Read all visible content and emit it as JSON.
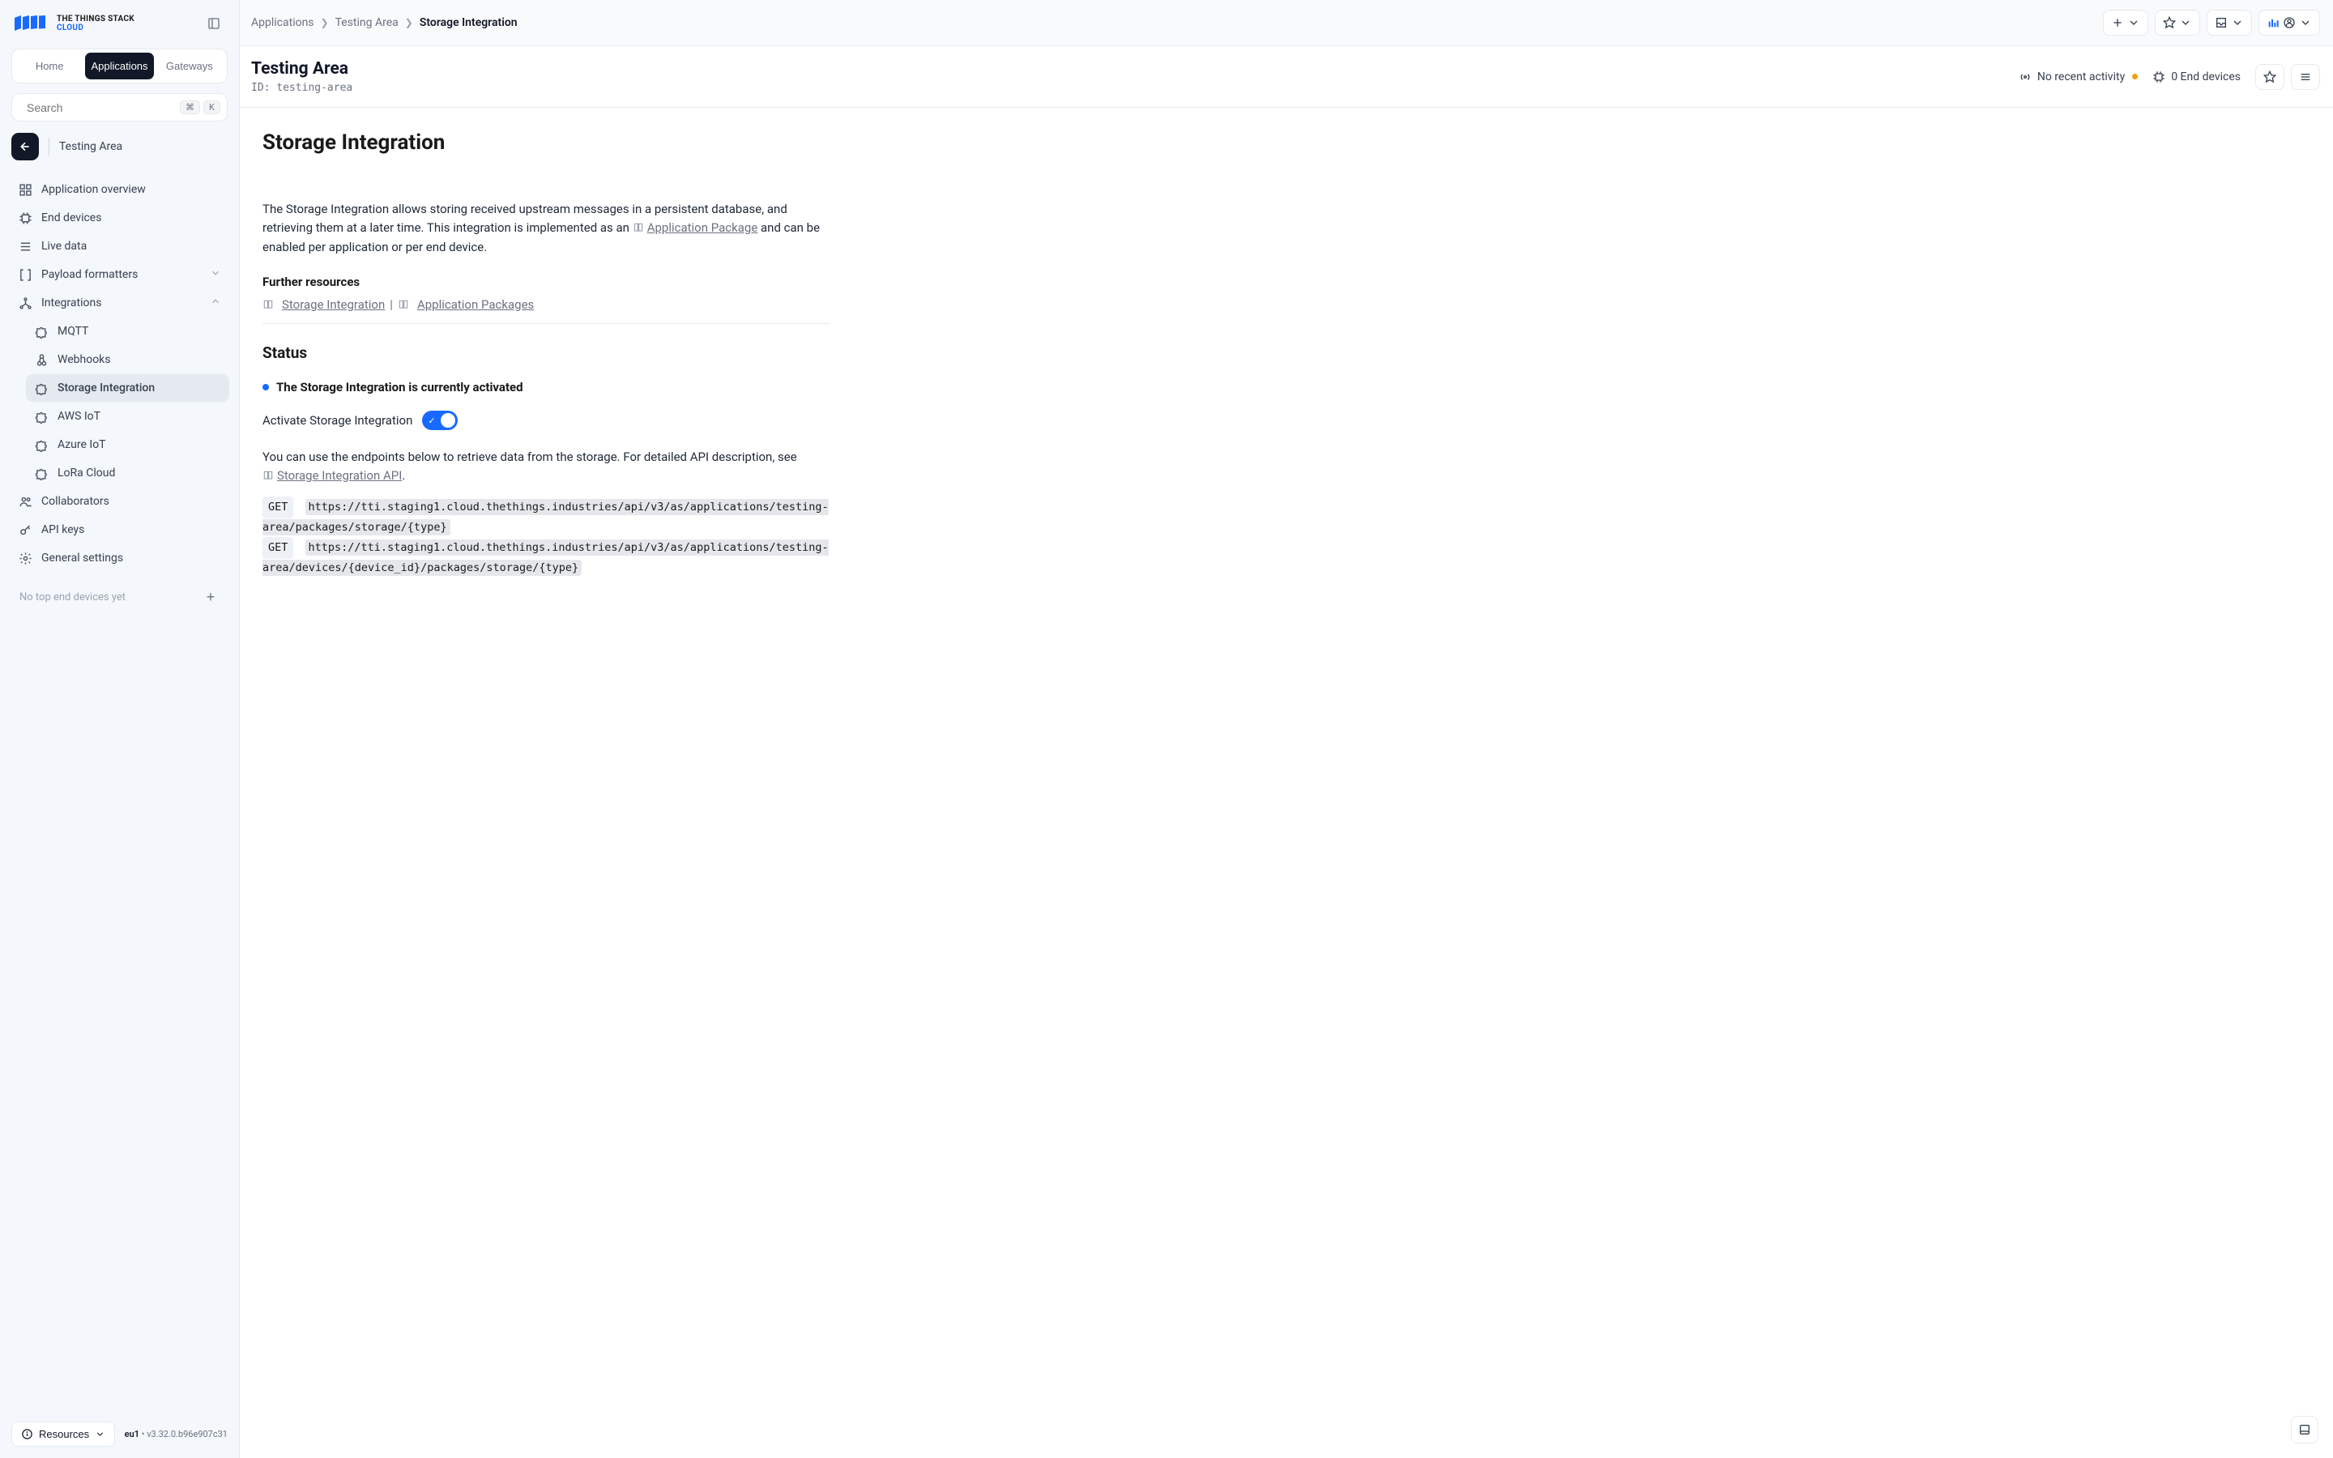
{
  "brand": {
    "title": "THE THINGS STACK",
    "subtitle": "CLOUD"
  },
  "tabs": {
    "home": "Home",
    "applications": "Applications",
    "gateways": "Gateways"
  },
  "search": {
    "placeholder": "Search",
    "kbd1": "⌘",
    "kbd2": "K"
  },
  "context": {
    "name": "Testing Area"
  },
  "nav": {
    "overview": "Application overview",
    "end_devices": "End devices",
    "live_data": "Live data",
    "payload": "Payload formatters",
    "integrations": "Integrations",
    "mqtt": "MQTT",
    "webhooks": "Webhooks",
    "storage": "Storage Integration",
    "aws": "AWS IoT",
    "azure": "Azure IoT",
    "lora": "LoRa Cloud",
    "collaborators": "Collaborators",
    "api_keys": "API keys",
    "general": "General settings"
  },
  "top_devices_empty": "No top end devices yet",
  "footer": {
    "resources": "Resources",
    "region": "eu1",
    "separator": " • ",
    "version": "v3.32.0.b96e907c31"
  },
  "breadcrumbs": {
    "a": "Applications",
    "b": "Testing Area",
    "c": "Storage Integration"
  },
  "header": {
    "title": "Testing Area",
    "id_label": "ID: ",
    "id_value": "testing-area",
    "activity": "No recent activity",
    "devices": "0 End devices"
  },
  "page": {
    "title": "Storage Integration",
    "intro1": "The Storage Integration allows storing received upstream messages in a persistent database, and retrieving them at a later time. This integration is implemented as an ",
    "intro_link": "Application Package",
    "intro2": " and can be enabled per application or per end device.",
    "further": "Further resources",
    "res_link1": "Storage Integration",
    "res_sep": " | ",
    "res_link2": "Application Packages",
    "status_title": "Status",
    "status_text": "The Storage Integration is currently activated",
    "toggle_label": "Activate Storage Integration",
    "endpoints_intro": "You can use the endpoints below to retrieve data from the storage. For detailed API description, see",
    "endpoints_link": "Storage Integration API",
    "endpoints_period": ".",
    "method1": "GET",
    "url1": "https://tti.staging1.cloud.thethings.industries/api/v3/as/applications/testing-area/packages/storage/{type}",
    "method2": "GET",
    "url2": "https://tti.staging1.cloud.thethings.industries/api/v3/as/applications/testing-area/devices/{device_id}/packages/storage/{type}"
  }
}
